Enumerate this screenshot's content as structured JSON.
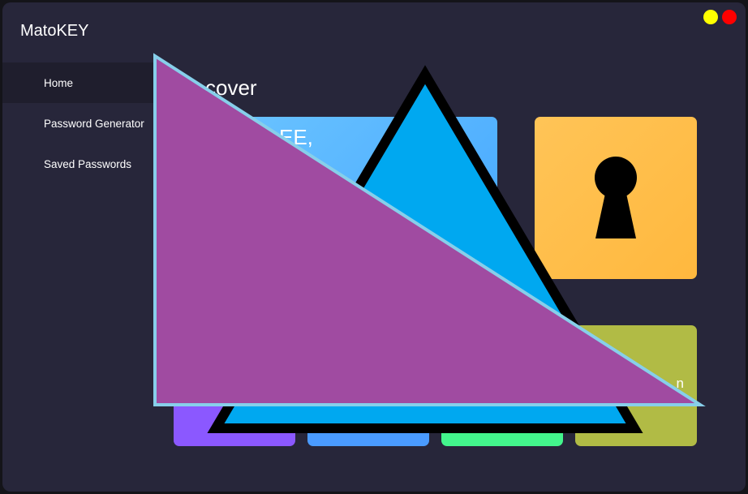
{
  "app": {
    "title": "MatoKEY"
  },
  "window_controls": {
    "minimize_color": "#ffff00",
    "close_color": "#ff0000"
  },
  "nav": {
    "items": [
      {
        "label": "Home",
        "active": true
      },
      {
        "label": "Password Generator",
        "active": false
      },
      {
        "label": "Saved Passwords",
        "active": false
      }
    ]
  },
  "main": {
    "section_title": "cover",
    "welcome_card": {
      "text": "EE,",
      "color": "#5bb6ff"
    },
    "vault_card": {
      "icon": "keyhole-icon",
      "color": "#ffbe4a"
    },
    "olive_card": {
      "text": "n",
      "color": "#b1bb45"
    },
    "tiles": [
      {
        "color": "#8b58ff"
      },
      {
        "color": "#4a9bff"
      },
      {
        "color": "#43f58c"
      }
    ]
  },
  "overlay": {
    "triangle_fill": "#00a8f0",
    "triangle_stroke": "#000000",
    "right_triangle_fill": "#a04ba1",
    "right_triangle_stroke": "#87cfea"
  }
}
